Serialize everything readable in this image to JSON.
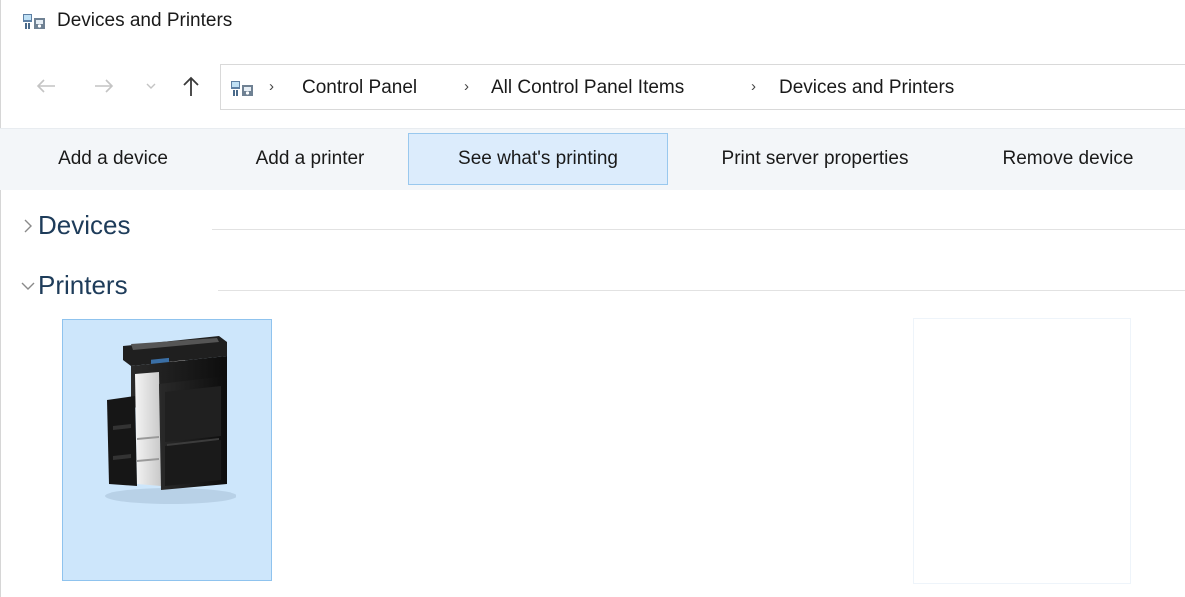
{
  "window": {
    "title": "Devices and Printers",
    "icon": "devices-and-printers-icon"
  },
  "navigation": {
    "back_icon": "back-arrow-icon",
    "forward_icon": "forward-arrow-icon",
    "recent_icon": "chevron-down-icon",
    "up_icon": "up-arrow-icon",
    "breadcrumb": [
      "Control Panel",
      "All Control Panel Items",
      "Devices and Printers"
    ],
    "separator": "›"
  },
  "toolbar": {
    "add_device": "Add a device",
    "add_printer": "Add a printer",
    "see_printing": "See what's printing",
    "server_properties": "Print server properties",
    "remove_device": "Remove device"
  },
  "groups": {
    "devices": {
      "label": "Devices",
      "state": "collapsed"
    },
    "printers": {
      "label": "Printers",
      "state": "expanded"
    }
  },
  "printers": [
    {
      "icon": "multifunction-printer-icon",
      "label": "",
      "selected": true
    }
  ],
  "colors": {
    "selection_fill": "#cde6fb",
    "selection_border": "#8fc3ee",
    "toolbar_bg": "#f3f6f9",
    "group_label": "#1e3c5a"
  }
}
